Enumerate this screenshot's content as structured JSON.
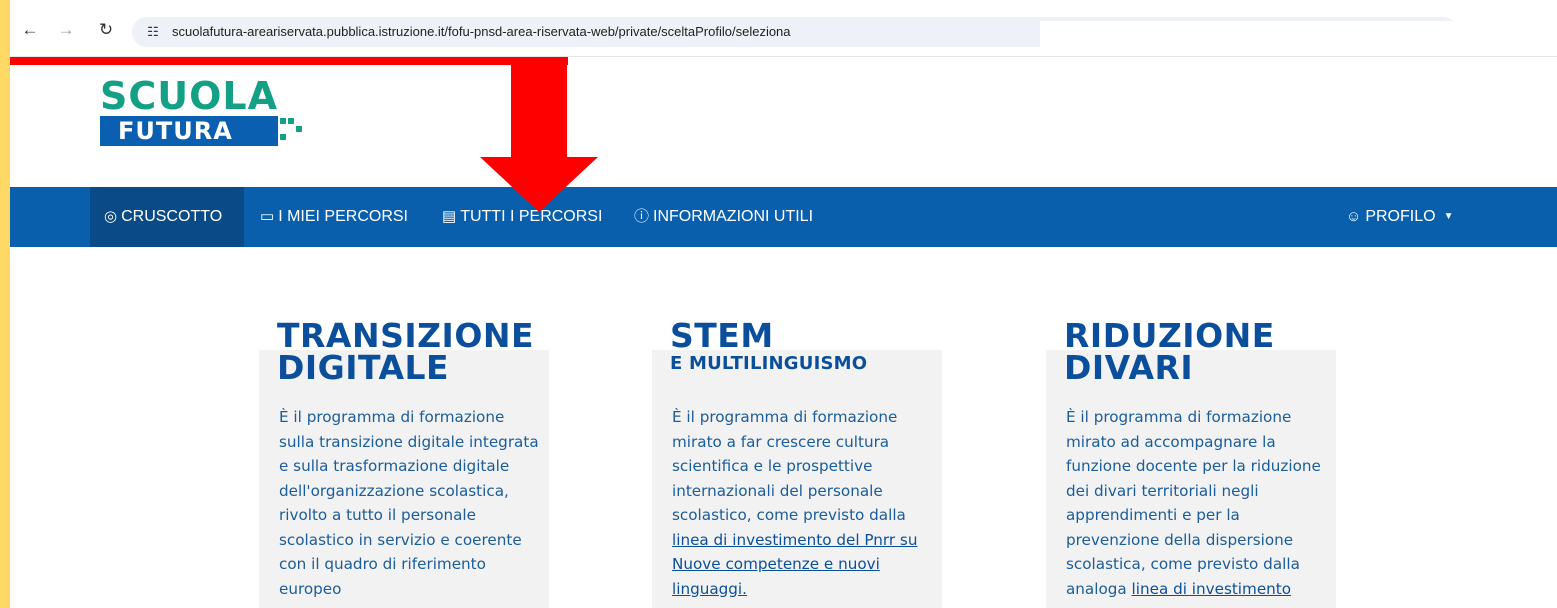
{
  "browser": {
    "url": "scuolafutura-areariservata.pubblica.istruzione.it/fofu-pnsd-area-riservata-web/private/sceltaProfilo/seleziona"
  },
  "logo": {
    "line1": "SCUOLA",
    "line2": "FUTURA"
  },
  "nav": {
    "cruscotto": "CRUSCOTTO",
    "miei_percorsi": "I MIEI PERCORSI",
    "tutti_percorsi": "TUTTI I PERCORSI",
    "informazioni": "INFORMAZIONI UTILI",
    "profilo": "PROFILO"
  },
  "cards": [
    {
      "title_line1": "TRANSIZIONE",
      "title_line2": "DIGITALE",
      "text": "È il programma di formazione sulla transizione digitale integrata e sulla trasformazione digitale dell'organizzazione scolastica, rivolto a tutto il personale scolastico in servizio e coerente con il quadro di riferimento europeo"
    },
    {
      "title_line1": "STEM",
      "title_line2": "E MULTILINGUISMO",
      "text": "È il programma di formazione mirato a far crescere cultura scientifica e le prospettive internazionali del personale scolastico, come previsto dalla ",
      "link": "linea di investimento del Pnrr su Nuove competenze e nuovi linguaggi."
    },
    {
      "title_line1": "RIDUZIONE",
      "title_line2": "DIVARI",
      "text": "È il programma di formazione mirato ad accompagnare la funzione docente per la riduzione dei divari territoriali negli apprendimenti e per la prevenzione della dispersione scolastica, come previsto dalla analoga ",
      "link": "linea di investimento"
    }
  ],
  "colors": {
    "navbar": "#0a5fad",
    "navbar_active": "#0a4a87",
    "brand_green": "#14a085",
    "title_blue": "#0b4f9c",
    "annotation_red": "#ff0000",
    "frame_yellow": "#ffd966"
  }
}
